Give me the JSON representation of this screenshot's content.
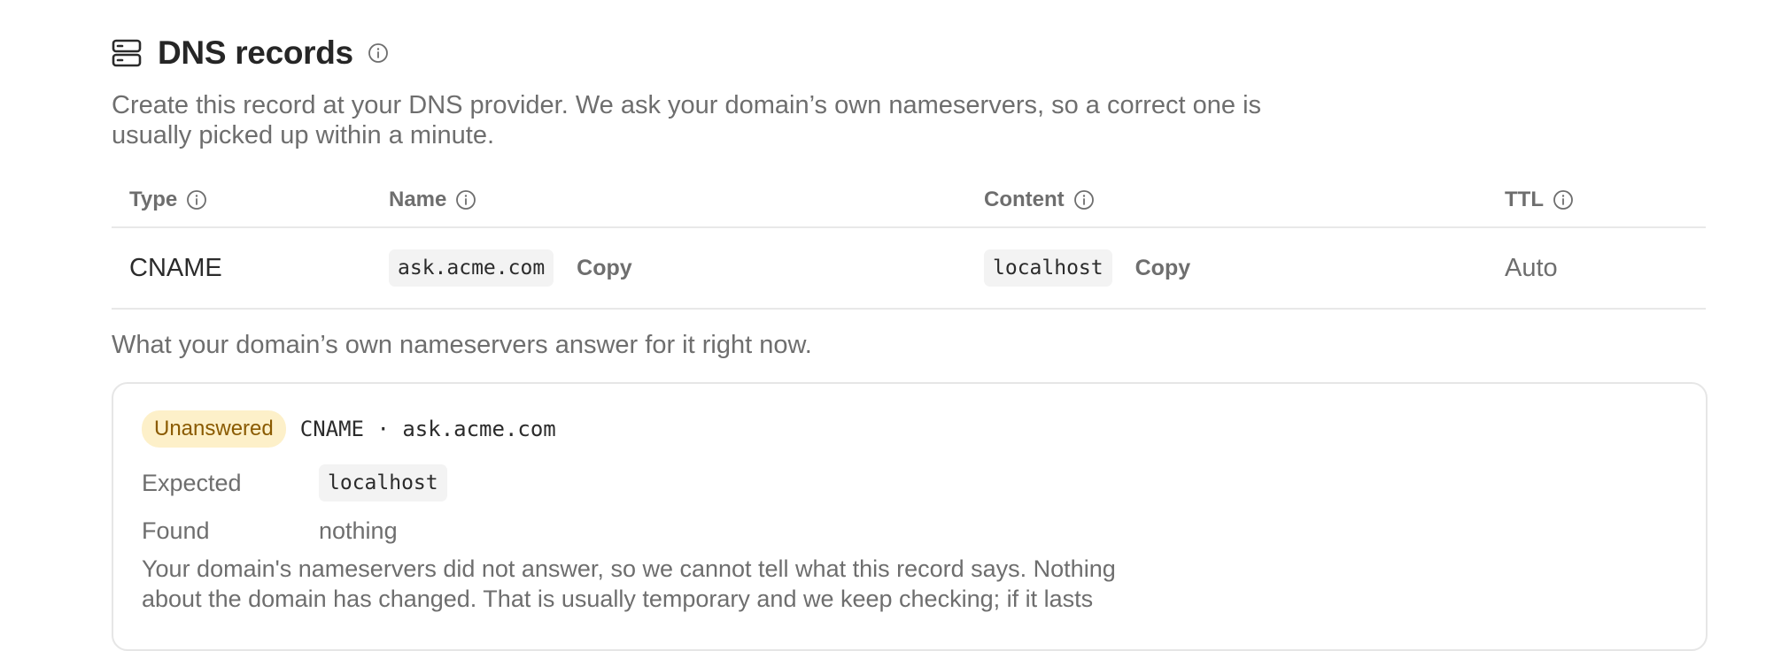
{
  "header": {
    "title": "DNS records",
    "description": "Create this record at your DNS provider. We ask your domain’s own nameservers, so a correct one is usually picked up within a minute."
  },
  "table": {
    "columns": {
      "type": "Type",
      "name": "Name",
      "content": "Content",
      "ttl": "TTL"
    },
    "rows": [
      {
        "type": "CNAME",
        "name": "ask.acme.com",
        "copy_name": "Copy",
        "content": "localhost",
        "copy_content": "Copy",
        "ttl": "Auto"
      }
    ]
  },
  "status": {
    "subtitle": "What your domain’s own nameservers answer for it right now.",
    "badge": "Unanswered",
    "badge_color": "#fdf0c9",
    "record": "CNAME · ask.acme.com",
    "expected_label": "Expected",
    "expected_value": "localhost",
    "found_label": "Found",
    "found_value": "nothing",
    "note": "Your domain's nameservers did not answer, so we cannot tell what this record says. Nothing about the domain has changed. That is usually temporary and we keep checking; if it lasts"
  },
  "icons": {
    "header": "server-icon",
    "info": "info-icon"
  }
}
